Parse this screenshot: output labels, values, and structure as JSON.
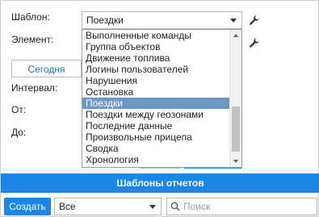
{
  "form": {
    "template_label": "Шаблон:",
    "template_value": "Поездки",
    "element_label": "Элемент:",
    "today_button": "Сегодня",
    "interval_label": "Интервал:",
    "from_label": "От:",
    "to_label": "До:"
  },
  "dropdown": {
    "items": [
      "Выполненные команды",
      "Группа объектов",
      "Движение топлива",
      "Логины пользователей",
      "Нарушения",
      "Остановка",
      "Поездки",
      "Поездки между геозонами",
      "Последние данные",
      "Произвольные прицепа",
      "Сводка",
      "Хронология"
    ],
    "selected_index": 6
  },
  "banner": {
    "title": "Шаблоны отчетов"
  },
  "bottom": {
    "create_button": "Создать",
    "filter_value": "Все",
    "search_placeholder": "Поиск"
  },
  "colors": {
    "accent": "#1a87e6",
    "selected_item": "#6b97c9",
    "link_text": "#1a6fc9"
  },
  "icons": {
    "template_settings": "wrench-icon",
    "element_settings": "wrench-icon",
    "search": "search-icon",
    "dropdown_caret": "chevron-down-icon"
  }
}
